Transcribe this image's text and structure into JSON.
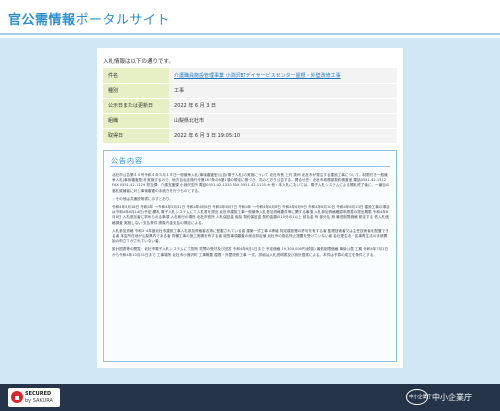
{
  "header": {
    "title_main": "官公需情報",
    "title_sub": "ポータルサイト"
  },
  "main": {
    "intro": "入札情報は以下の通りです。",
    "rows": [
      {
        "label": "件名",
        "value": "介護職員施設管理事業 小渕沢町デイサービスセンター屋根・外壁改修工事"
      },
      {
        "label": "種別",
        "value": "工事"
      },
      {
        "label": "公示日または更新日",
        "value": "2022 年 6 月 3 日"
      },
      {
        "label": "組織",
        "value": "山梨県北杜市"
      },
      {
        "label": "取得日",
        "value": "2022 年 6 月 3 日 19:05:10"
      }
    ],
    "notice": {
      "title": "公告内容",
      "paragraphs": [
        "北杜市公告第４４号令和４年５月１８日一般競争入札(事後審査型)公告(電子入札)の実施について 北杜市長 上村 英司 北杜市が発注する建設工事について、制限付き一般競争入札(事後審査型)を実施するので、地方自治法施行令第167条の6第1項の規定に基づき、次のとおり公告する。問合せ先：北杜市総務部契約検査室 電話0551-42-1312 FAX 0551-42-1129 担当課：介護支援課 小淵沢支所 電話0551-42-1333 FAX 0551-42-1125 ※ 他・本入札においては、電子入札システムによる開札終了後に、一番目の落札候補者に対し事後審査の手続きを行うものとする。",
        "・その他は共通説明書に示すとおり。",
        "令和4年5月18日 令和4年 ～令和4年5月31日 令和4年6月6日 令和4年6月7日 令和4年 ～令和4年6月8日 令和4年6月9日 令和4年6月10日 令和4年6月13日 建設工事の場合は令和4年6月14日(予定)開札 電子入札システムにて入札書を提出 北杜市建設工事一般競争入札参加資格要件等に関する事項 入札参加資格確認申請書の提出期限 令和4年6月8日 入札参加者に求められる事項 入札執行の場所 北杜市役所 入札保証金 免除 契約保証金 契約金額の10分の1以上 前払金 有 部分払 無 最低制限価格 設定する 低入札価格調査 実施しない 支払条件 請負代金支払の規定による。",
        "入札参加資格 令和3･4年度北杜市建設工事入札参加資格者名簿に登載されている者 建築一式工事 A等級 特定建設業の許可を有する者 監理技術者又は主任技術者を配置できる者 本店所在地が山梨県内である者 同種工事の施工実績を有する者 経営事項審査の総合評定値 北杜市の指名停止措置を受けていない者 会社更生法・民事再生法の手続開始の申立てがされていない者。",
        "設計図書等の閲覧：北杜市電子入札システムにて配布 質問の受付及び回答 令和4年6月1日まで 予定価格 19,300,000円(税抜) 最低制限価格 事後公表 工期 令和4年7月1日から令和4年10月31日まで 工事場所 北杜市小淵沢町 工事概要 屋根・外壁改修工事 一式。詳細は入札説明書及び設計図書による。本件は予算の成立を条件とする。"
      ]
    }
  },
  "footer": {
    "secured_line1": "SECURED",
    "secured_line2": "by SAKURA",
    "agency_logo": "中小企業庁",
    "agency_name": "中小企業庁"
  }
}
